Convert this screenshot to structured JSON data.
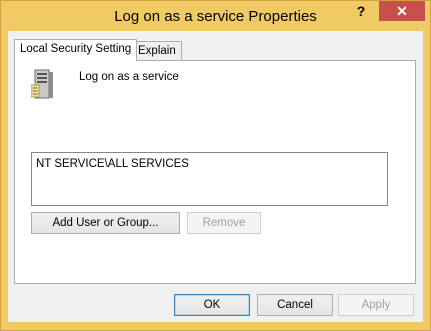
{
  "window": {
    "title": "Log on as a service Properties",
    "help_glyph": "?",
    "close_glyph": "✕",
    "accent_color": "#f2ca63",
    "close_color": "#c7504a"
  },
  "tabs": [
    {
      "label": "Local Security Setting",
      "active": true
    },
    {
      "label": "Explain",
      "active": false
    }
  ],
  "policy": {
    "title": "Log on as a service",
    "icon": "server-icon"
  },
  "members": [
    "NT SERVICE\\ALL SERVICES"
  ],
  "actions": {
    "add_label": "Add User or Group...",
    "remove_label": "Remove"
  },
  "footer": {
    "ok_label": "OK",
    "cancel_label": "Cancel",
    "apply_label": "Apply"
  }
}
